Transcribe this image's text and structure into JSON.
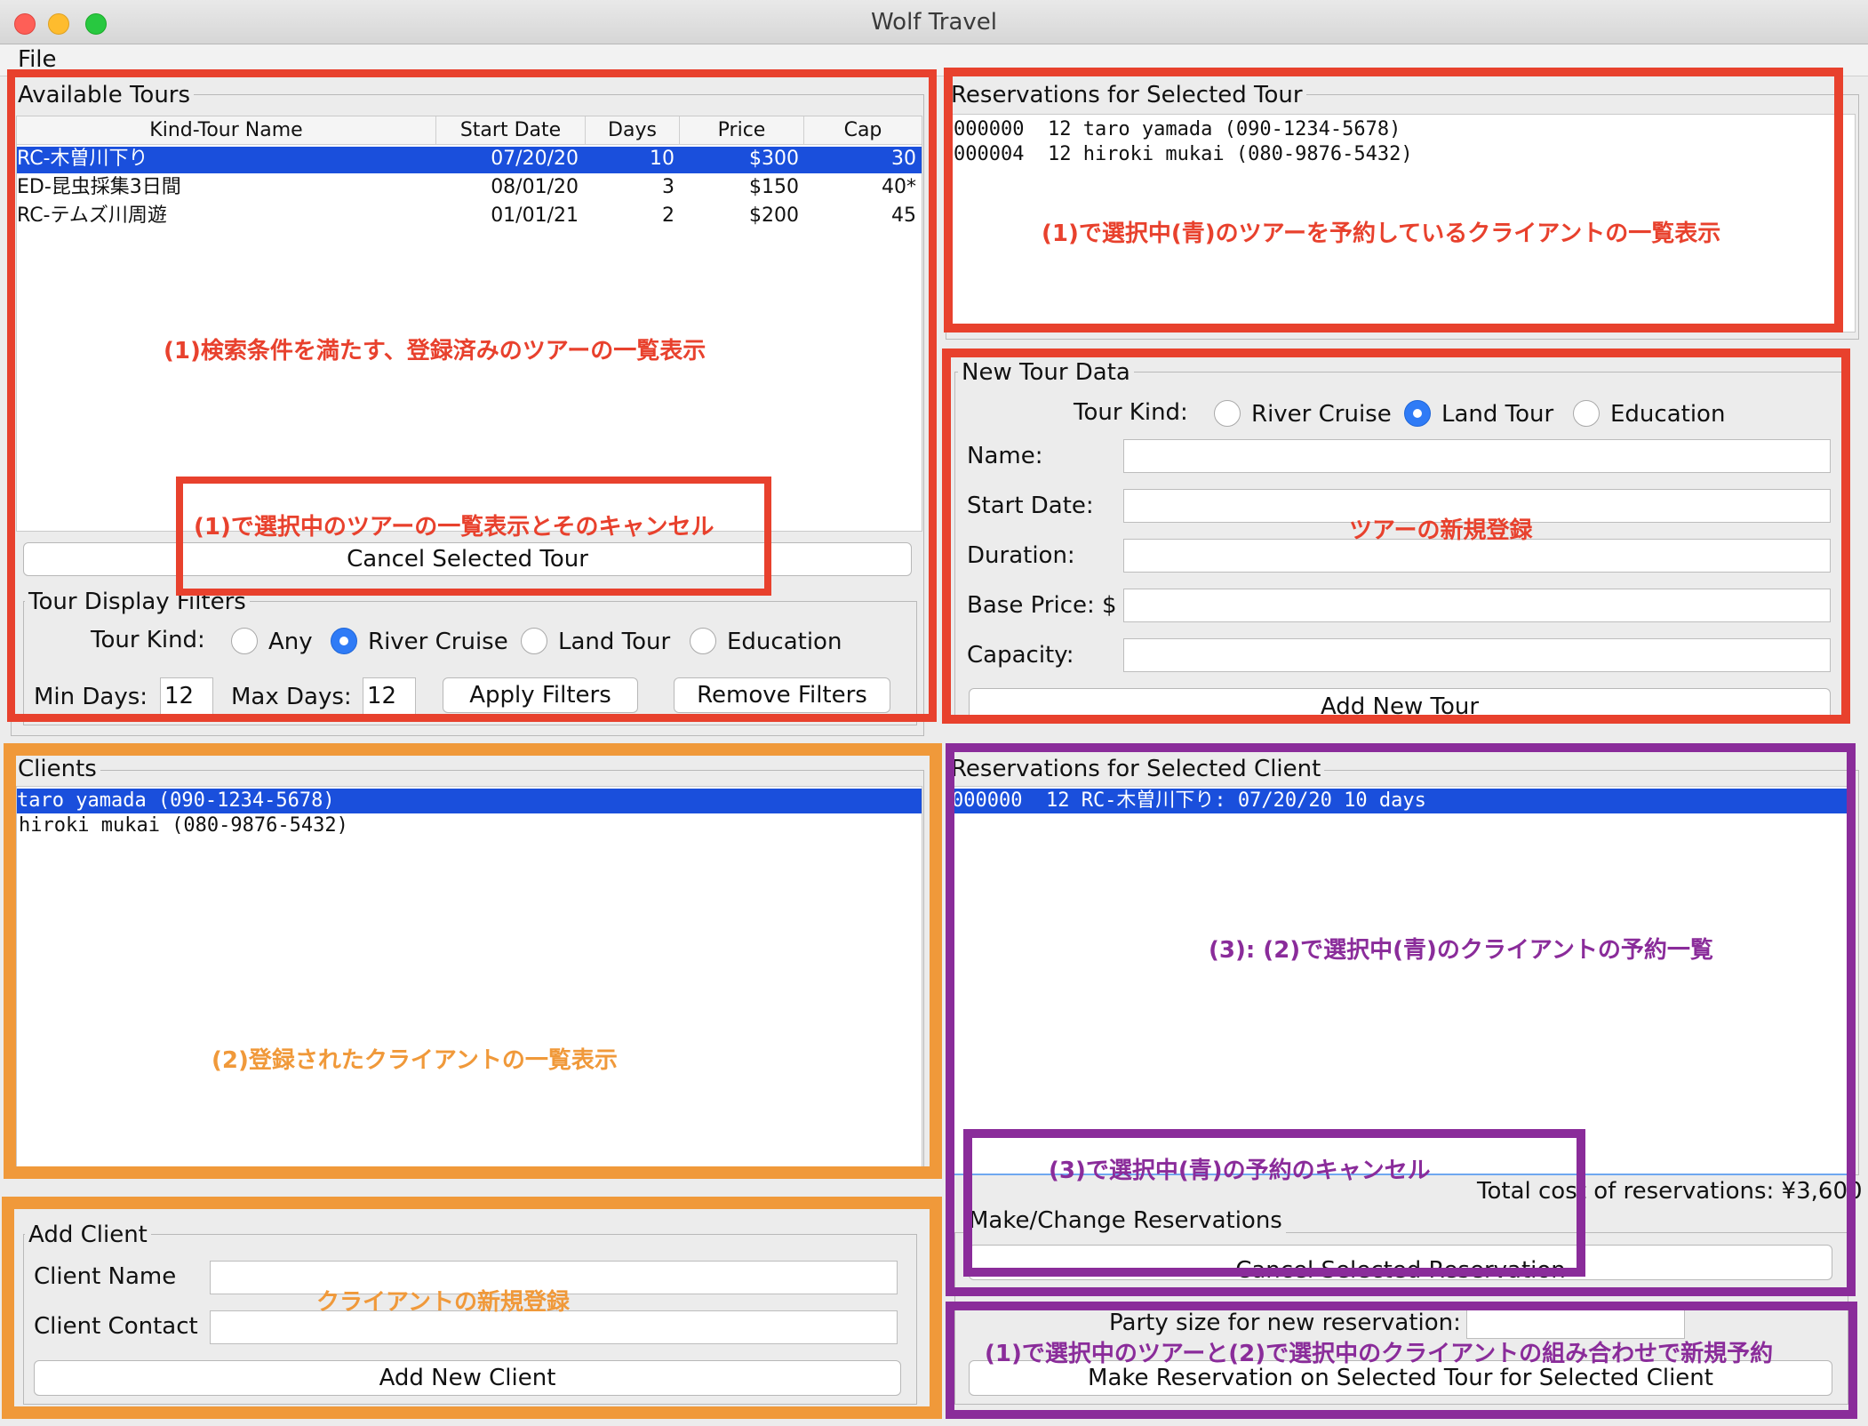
{
  "window": {
    "title": "Wolf Travel"
  },
  "menu": {
    "file": "File"
  },
  "available_tours": {
    "title": "Available Tours",
    "columns": [
      "Kind-Tour Name",
      "Start Date",
      "Days",
      "Price",
      "Cap"
    ],
    "rows": [
      [
        "RC-木曽川下り",
        "07/20/20",
        "10",
        "$300",
        "30"
      ],
      [
        "ED-昆虫採集3日間",
        "08/01/20",
        "3",
        "$150",
        "40*"
      ],
      [
        "RC-テムズ川周遊",
        "01/01/21",
        "2",
        "$200",
        "45"
      ]
    ],
    "cancel_button": "Cancel Selected Tour"
  },
  "filters": {
    "title": "Tour Display Filters",
    "tour_kind_label": "Tour Kind:",
    "options": [
      "Any",
      "River Cruise",
      "Land Tour",
      "Education"
    ],
    "selected": "River Cruise",
    "min_days_label": "Min Days:",
    "min_days_value": "12",
    "max_days_label": "Max Days:",
    "max_days_value": "12",
    "apply_button": "Apply Filters",
    "remove_button": "Remove Filters"
  },
  "tour_reservations": {
    "title": "Reservations for Selected Tour",
    "items": [
      "000000  12 taro yamada (090-1234-5678)",
      "000004  12 hiroki mukai (080-9876-5432)"
    ]
  },
  "new_tour": {
    "title": "New Tour Data",
    "tour_kind_label": "Tour Kind:",
    "options": [
      "River Cruise",
      "Land Tour",
      "Education"
    ],
    "selected": "Land Tour",
    "name_label": "Name:",
    "start_date_label": "Start Date:",
    "duration_label": "Duration:",
    "base_price_label": "Base Price: $",
    "capacity_label": "Capacity:",
    "add_button": "Add New Tour"
  },
  "clients": {
    "title": "Clients",
    "items": [
      "taro yamada (090-1234-5678)",
      "hiroki mukai (080-9876-5432)"
    ]
  },
  "add_client": {
    "title": "Add Client",
    "name_label": "Client Name",
    "contact_label": "Client Contact",
    "add_button": "Add New Client"
  },
  "client_reservations": {
    "title": "Reservations for Selected Client",
    "items": [
      "000000  12 RC-木曽川下り: 07/20/20 10 days"
    ],
    "total": "Total cost of reservations: ¥3,600"
  },
  "make_change": {
    "title": "Make/Change Reservations",
    "cancel_button": "Cancel Selected Reservation",
    "party_size_label": "Party size for new reservation:",
    "make_button": "Make Reservation on Selected Tour for Selected Client"
  },
  "annotations": {
    "tours_list": "(1)検索条件を満たす、登録済みのツアーの一覧表示",
    "tour_cancel": "(1)で選択中のツアーの一覧表示とそのキャンセル",
    "tour_reservations": "(1)で選択中(青)のツアーを予約しているクライアントの一覧表示",
    "new_tour": "ツアーの新規登録",
    "clients": "(2)登録されたクライアントの一覧表示",
    "add_client": "クライアントの新規登録",
    "client_reservations": "(3): (2)で選択中(青)のクライアントの予約一覧",
    "reservation_cancel": "(3)で選択中(青)の予約のキャンセル",
    "make_reservation": "(1)で選択中のツアーと(2)で選択中のクライアントの組み合わせで新規予約"
  },
  "colors": {
    "selection": "#1a4fdc",
    "red": "#e8412d",
    "orange": "#f0993a",
    "purple": "#8a2c9a"
  }
}
